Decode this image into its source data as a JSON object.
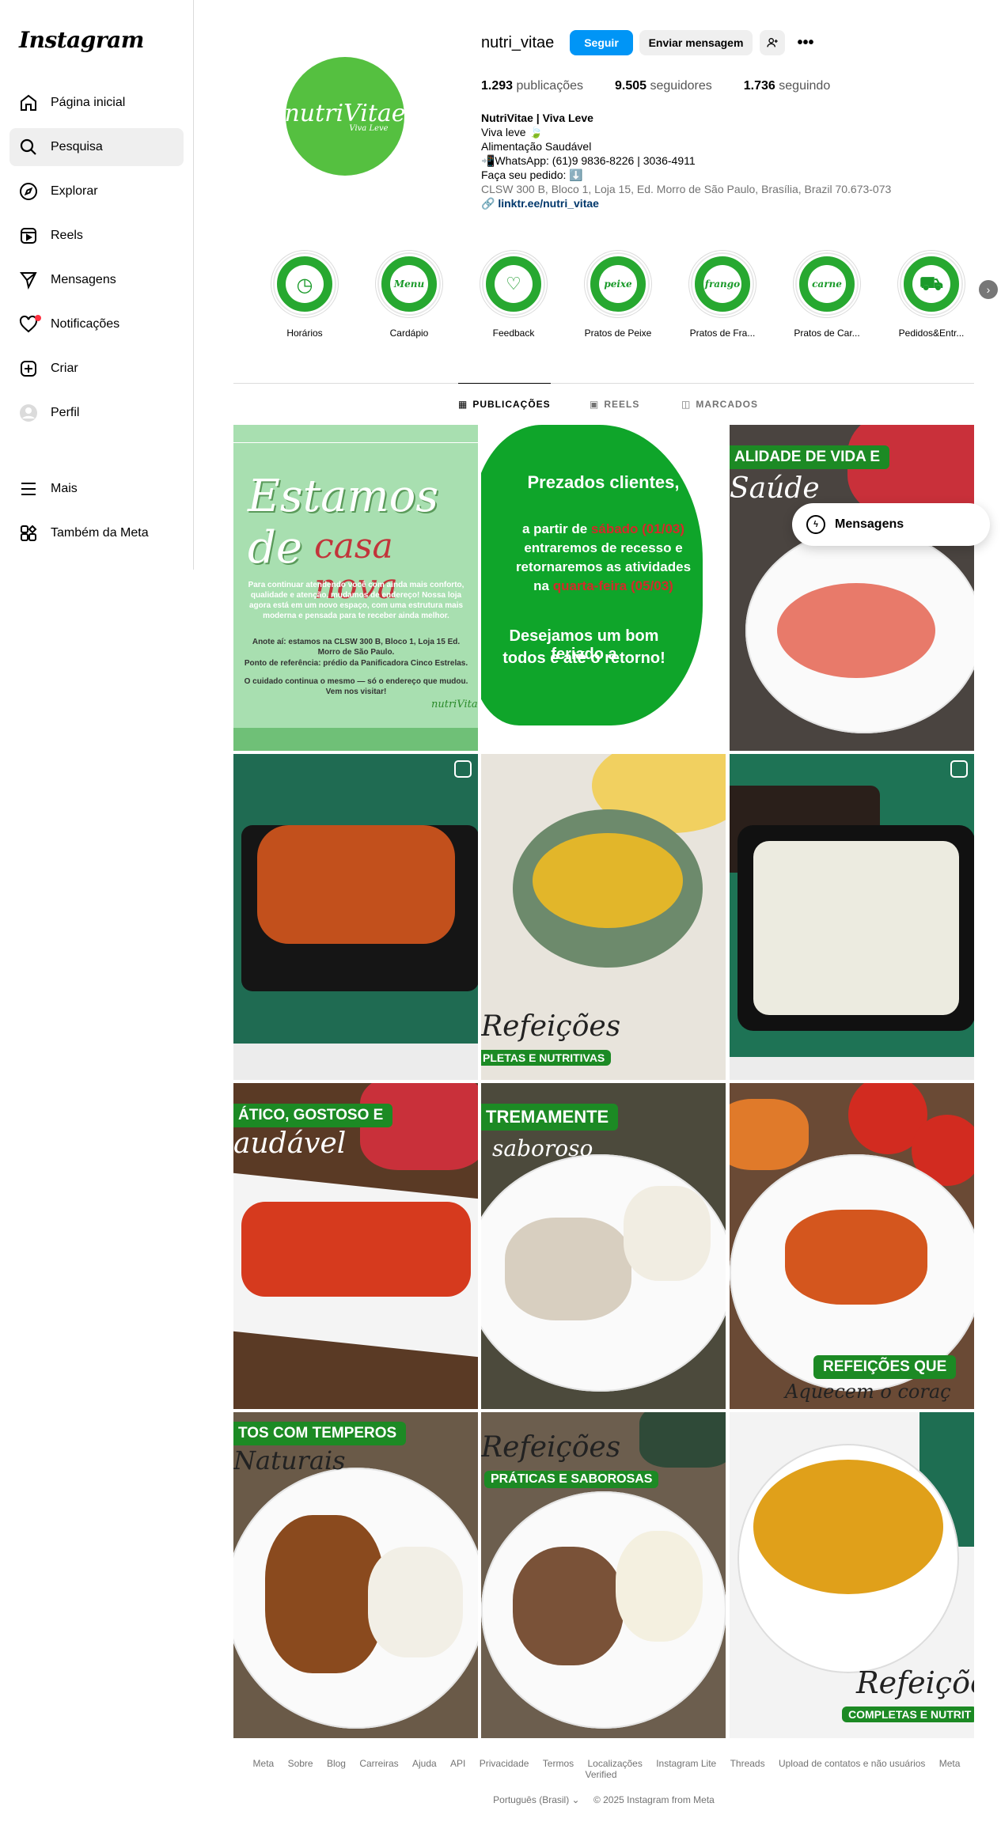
{
  "app": {
    "logo": "Instagram"
  },
  "sidebar": {
    "items": [
      {
        "label": "Página inicial",
        "icon": "home-icon"
      },
      {
        "label": "Pesquisa",
        "icon": "search-icon"
      },
      {
        "label": "Explorar",
        "icon": "compass-icon"
      },
      {
        "label": "Reels",
        "icon": "reels-icon"
      },
      {
        "label": "Mensagens",
        "icon": "send-icon"
      },
      {
        "label": "Notificações",
        "icon": "heart-icon"
      },
      {
        "label": "Criar",
        "icon": "plus-square-icon"
      },
      {
        "label": "Perfil",
        "icon": "avatar-icon"
      }
    ],
    "more": {
      "label": "Mais",
      "icon": "menu-icon"
    },
    "meta": {
      "label": "Também da Meta",
      "icon": "grid-icon"
    }
  },
  "profile": {
    "username": "nutri_vitae",
    "follow_label": "Seguir",
    "message_label": "Enviar mensagem",
    "avatar_brand": "nutriVitae",
    "avatar_tag": "Viva Leve",
    "stats": {
      "posts": "1.293",
      "posts_label": "publicações",
      "followers": "9.505",
      "followers_label": "seguidores",
      "following": "1.736",
      "following_label": "seguindo"
    },
    "bio": {
      "name": "NutriVitae | Viva Leve",
      "line1": "Viva leve 🍃",
      "line2": "Alimentação Saudável",
      "line3": "📲WhatsApp: (61)9 9836-8226 | 3036-4911",
      "line4": "Faça seu pedido: ⬇️",
      "address": "CLSW 300 B, Bloco 1, Loja 15, Ed. Morro de São Paulo, Brasília, Brazil 70.673-073",
      "link": "linktr.ee/nutri_vitae"
    }
  },
  "highlights": [
    {
      "label": "Horários",
      "icon_text": "◷"
    },
    {
      "label": "Cardápio",
      "icon_text": "Menu"
    },
    {
      "label": "Feedback",
      "icon_text": "♡"
    },
    {
      "label": "Pratos de Peixe",
      "icon_text": "peixe"
    },
    {
      "label": "Pratos de Fra...",
      "icon_text": "frango"
    },
    {
      "label": "Pratos de Car...",
      "icon_text": "carne"
    },
    {
      "label": "Pedidos&Entr...",
      "icon_text": "⛟"
    }
  ],
  "tabs": [
    {
      "label": "PUBLICAÇÕES",
      "icon": "grid-tab-icon"
    },
    {
      "label": "REELS",
      "icon": "reels-tab-icon"
    },
    {
      "label": "MARCADOS",
      "icon": "tagged-tab-icon"
    }
  ],
  "posts": {
    "p1": {
      "title1": "Estamos de",
      "title2": "casa nova",
      "body": "Para continuar atendendo você com ainda mais conforto, qualidade e atenção, mudamos de endereço! Nossa loja agora está em um novo espaço, com uma estrutura mais moderna e pensada para te receber ainda melhor.",
      "anote": "Anote aí: estamos na CLSW 300 B, Bloco 1, Loja 15 Ed. Morro de São Paulo.",
      "ref": "Ponto de referência: prédio da Panificadora Cinco Estrelas.",
      "closing": "O cuidado continua o mesmo — só o endereço que mudou. Vem nos visitar!",
      "sig": "nutriVitae"
    },
    "p2": {
      "l1": "Prezados clientes,",
      "l2": "a partir de",
      "l2r": "sábado (01/03)",
      "l3": "entraremos de recesso e",
      "l4": "retornaremos as atividades",
      "l5": "na",
      "l5r": "quarta-feira (05/03)",
      "l6": "Desejamos um bom feriado a",
      "l7": "todos e até o retorno!"
    },
    "p3": {
      "ribbon": "ALIDADE DE VIDA E",
      "script": "Saúde"
    },
    "p5": {
      "script": "Refeições",
      "ribbon": "PLETAS E NUTRITIVAS"
    },
    "p7": {
      "ribbon": "ÁTICO, GOSTOSO E",
      "script": "audável"
    },
    "p8": {
      "ribbon": "TREMAMENTE",
      "script": "saboroso"
    },
    "p9": {
      "ribbon": "REFEIÇÕES QUE",
      "script": "Aquecem o coraç"
    },
    "p10": {
      "ribbon": "TOS COM TEMPEROS",
      "script": "Naturais"
    },
    "p11": {
      "script": "Refeições",
      "ribbon": "PRÁTICAS E SABOROSAS"
    },
    "p12": {
      "script": "Refeiçõe",
      "ribbon": "COMPLETAS E NUTRIT"
    }
  },
  "floating": {
    "label": "Mensagens"
  },
  "footer": {
    "links": [
      "Meta",
      "Sobre",
      "Blog",
      "Carreiras",
      "Ajuda",
      "API",
      "Privacidade",
      "Termos",
      "Localizações",
      "Instagram Lite",
      "Threads",
      "Upload de contatos e não usuários",
      "Meta Verified"
    ],
    "language": "Português (Brasil) ⌄",
    "copyright": "© 2025 Instagram from Meta"
  },
  "colors": {
    "accent": "#0095f6",
    "brand_green": "#1c8a24",
    "text_muted": "#737373"
  }
}
